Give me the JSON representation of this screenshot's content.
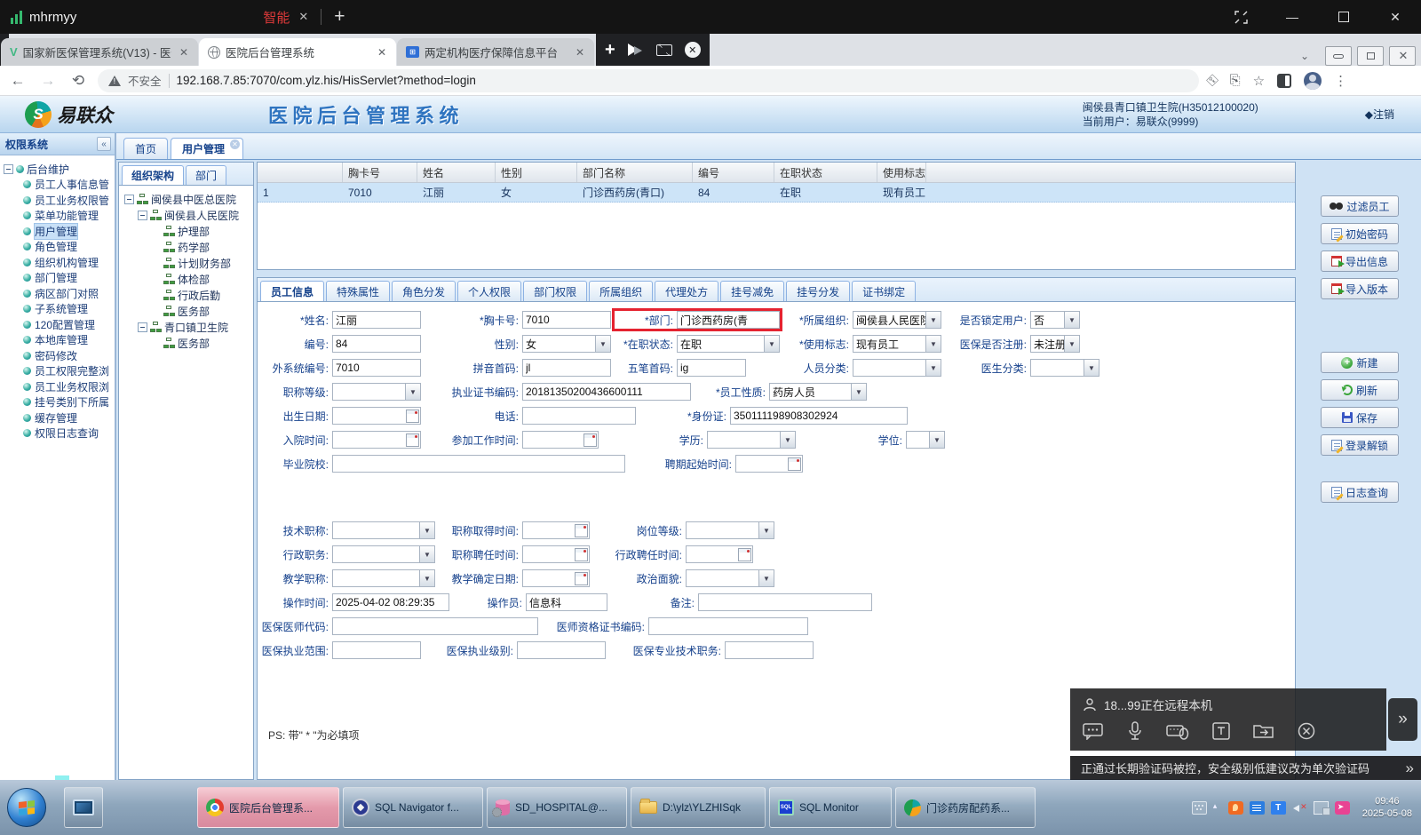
{
  "window": {
    "title": "mhrmyy",
    "smart_tab": "智能",
    "close": "✕",
    "plus": "+",
    "minimize": "—"
  },
  "browser": {
    "tabs": [
      {
        "label": "国家新医保管理系统(V13) - 医保"
      },
      {
        "label": "医院后台管理系统",
        "active": true
      },
      {
        "label": "两定机构医疗保障信息平台"
      }
    ],
    "address": {
      "security": "不安全",
      "url": "192.168.7.85:7070/com.ylz.his/HisServlet?method=login"
    }
  },
  "app_header": {
    "brand": "易联众",
    "title": "医 院 后 台 管 理 系 统",
    "org": "闽侯县青口镇卫生院(H35012100020)",
    "current_user": "当前用户：易联众(9999)",
    "logout": "◆注销"
  },
  "perm_sidebar": {
    "title": "权限系统",
    "collapse": "«",
    "root": "后台维护",
    "items": [
      {
        "label": "员工人事信息管"
      },
      {
        "label": "员工业务权限管"
      },
      {
        "label": "菜单功能管理"
      },
      {
        "label": "用户管理",
        "selected": true
      },
      {
        "label": "角色管理"
      },
      {
        "label": "组织机构管理"
      },
      {
        "label": "部门管理"
      },
      {
        "label": "病区部门对照"
      },
      {
        "label": "子系统管理"
      },
      {
        "label": "120配置管理"
      },
      {
        "label": "本地库管理"
      },
      {
        "label": "密码修改"
      },
      {
        "label": "员工权限完整浏"
      },
      {
        "label": "员工业务权限浏"
      },
      {
        "label": "挂号类别下所属"
      },
      {
        "label": "缓存管理"
      },
      {
        "label": "权限日志查询"
      }
    ]
  },
  "page_tabs": {
    "home": "首页",
    "current": "用户管理"
  },
  "org_panel": {
    "tabs": {
      "org": "组织架构",
      "dept": "部门"
    },
    "tree": [
      {
        "label": "闽侯县中医总医院",
        "level": 0,
        "expand": true
      },
      {
        "label": "闽侯县人民医院",
        "level": 1,
        "expand": true
      },
      {
        "label": "护理部",
        "level": 2
      },
      {
        "label": "药学部",
        "level": 2
      },
      {
        "label": "计划财务部",
        "level": 2
      },
      {
        "label": "体检部",
        "level": 2
      },
      {
        "label": "行政后勤",
        "level": 2
      },
      {
        "label": "医务部",
        "level": 2
      },
      {
        "label": "青口镇卫生院",
        "level": 1,
        "expand": true
      },
      {
        "label": "医务部",
        "level": 2
      }
    ]
  },
  "emp_table": {
    "columns": [
      "",
      "胸卡号",
      "姓名",
      "性别",
      "部门名称",
      "编号",
      "在职状态",
      "使用标志"
    ],
    "row": [
      "1",
      "7010",
      "江丽",
      "女",
      "门诊西药房(青口)",
      "84",
      "在职",
      "现有员工"
    ]
  },
  "right_buttons": {
    "filter": "过滤员工",
    "init_pwd": "初始密码",
    "export": "导出信息",
    "import": "导入版本",
    "new": "新建",
    "refresh": "刷新",
    "save": "保存",
    "unlock": "登录解锁",
    "log": "日志查询"
  },
  "detail_tabs": [
    "员工信息",
    "特殊属性",
    "角色分发",
    "个人权限",
    "部门权限",
    "所属组织",
    "代理处方",
    "挂号减免",
    "挂号分发",
    "证书绑定"
  ],
  "form": {
    "ps_note": "PS: 带\" * \"为必填项",
    "rows": [
      {
        "fields": [
          {
            "label": "*姓名:",
            "value": "江丽",
            "type": "text",
            "lw": 80,
            "iw": 100
          },
          {
            "label": "*胸卡号:",
            "value": "7010",
            "type": "text",
            "lw": 110,
            "iw": 100
          },
          {
            "label": "*部门:",
            "value": "门诊西药房(青",
            "type": "text",
            "lw": 70,
            "iw": 116,
            "highlight": true
          },
          {
            "label": "*所属组织:",
            "value": "闽侯县人民医院",
            "type": "select",
            "lw": 78,
            "iw": 100
          },
          {
            "label": "是否锁定用户:",
            "value": "否",
            "type": "select",
            "lw": 96,
            "iw": 56
          }
        ]
      },
      {
        "fields": [
          {
            "label": "编号:",
            "value": "84",
            "type": "text",
            "lw": 80,
            "iw": 100
          },
          {
            "label": "性别:",
            "value": "女",
            "type": "select",
            "lw": 110,
            "iw": 100
          },
          {
            "label": "*在职状态:",
            "value": "在职",
            "type": "select",
            "lw": 70,
            "iw": 116
          },
          {
            "label": "*使用标志:",
            "value": "现有员工",
            "type": "select",
            "lw": 78,
            "iw": 100
          },
          {
            "label": "医保是否注册:",
            "value": "未注册",
            "type": "select",
            "lw": 96,
            "iw": 56
          }
        ]
      },
      {
        "fields": [
          {
            "label": "外系统编号:",
            "value": "7010",
            "type": "text",
            "lw": 80,
            "iw": 100
          },
          {
            "label": "拼音首码:",
            "value": "jl",
            "type": "text",
            "lw": 110,
            "iw": 100
          },
          {
            "label": "五笔首码:",
            "value": "ig",
            "type": "text",
            "lw": 70,
            "iw": 78
          },
          {
            "label": "人员分类:",
            "value": "",
            "type": "select",
            "lw": 116,
            "iw": 100
          },
          {
            "label": "医生分类:",
            "value": "",
            "type": "select",
            "lw": 96,
            "iw": 78
          }
        ]
      },
      {
        "fields": [
          {
            "label": "职称等级:",
            "value": "",
            "type": "select",
            "lw": 80,
            "iw": 100
          },
          {
            "label": "执业证书编码:",
            "value": "20181350200436600111",
            "type": "text",
            "lw": 110,
            "iw": 190
          },
          {
            "label": "*员工性质:",
            "value": "药房人员",
            "type": "select",
            "lw": 84,
            "iw": 110
          }
        ]
      },
      {
        "fields": [
          {
            "label": "出生日期:",
            "value": "",
            "type": "date",
            "lw": 80,
            "iw": 100
          },
          {
            "label": "电话:",
            "value": "",
            "type": "text",
            "lw": 110,
            "iw": 128
          },
          {
            "label": "*身份证:",
            "value": "350111198908302924",
            "type": "text",
            "lw": 102,
            "iw": 200
          }
        ]
      },
      {
        "fields": [
          {
            "label": "入院时间:",
            "value": "",
            "type": "date",
            "lw": 80,
            "iw": 100
          },
          {
            "label": "参加工作时间:",
            "value": "",
            "type": "date",
            "lw": 110,
            "iw": 86
          },
          {
            "label": "学历:",
            "value": "",
            "type": "select",
            "lw": 118,
            "iw": 100
          },
          {
            "label": "学位:",
            "value": "",
            "type": "select",
            "lw": 120,
            "iw": 44
          }
        ]
      },
      {
        "fields": [
          {
            "label": "毕业院校:",
            "value": "",
            "type": "text",
            "lw": 80,
            "iw": 330
          },
          {
            "label": "聘期起始时间:",
            "value": "",
            "type": "date",
            "lw": 120,
            "iw": 76
          }
        ]
      },
      {
        "spacer": 48
      },
      {
        "fields": [
          {
            "label": "技术职称:",
            "value": "",
            "type": "select",
            "lw": 80,
            "iw": 116
          },
          {
            "label": "职称取得时间:",
            "value": "",
            "type": "date",
            "lw": 94,
            "iw": 76
          },
          {
            "label": "岗位等级:",
            "value": "",
            "type": "select",
            "lw": 104,
            "iw": 100
          }
        ]
      },
      {
        "fields": [
          {
            "label": "行政职务:",
            "value": "",
            "type": "select",
            "lw": 80,
            "iw": 116
          },
          {
            "label": "职称聘任时间:",
            "value": "",
            "type": "date",
            "lw": 94,
            "iw": 76
          },
          {
            "label": "行政聘任时间:",
            "value": "",
            "type": "date",
            "lw": 104,
            "iw": 76
          }
        ]
      },
      {
        "fields": [
          {
            "label": "教学职称:",
            "value": "",
            "type": "select",
            "lw": 80,
            "iw": 116
          },
          {
            "label": "教学确定日期:",
            "value": "",
            "type": "date",
            "lw": 94,
            "iw": 76
          },
          {
            "label": "政治面貌:",
            "value": "",
            "type": "select",
            "lw": 104,
            "iw": 100
          }
        ]
      },
      {
        "fields": [
          {
            "label": "操作时间:",
            "value": "2025-04-02 08:29:35",
            "type": "text",
            "lw": 80,
            "iw": 132
          },
          {
            "label": "操作员:",
            "value": "信息科",
            "type": "text",
            "lw": 82,
            "iw": 92
          },
          {
            "label": "备注:",
            "value": "",
            "type": "text",
            "lw": 98,
            "iw": 196
          }
        ]
      },
      {
        "fields": [
          {
            "label": "医保医师代码:",
            "value": "",
            "type": "text",
            "lw": 80,
            "iw": 232
          },
          {
            "label": "医师资格证书编码:",
            "value": "",
            "type": "text",
            "lw": 120,
            "iw": 180
          }
        ]
      },
      {
        "fields": [
          {
            "label": "医保执业范围:",
            "value": "",
            "type": "text",
            "lw": 80,
            "iw": 100
          },
          {
            "label": "医保执业级别:",
            "value": "",
            "type": "text",
            "lw": 104,
            "iw": 100
          },
          {
            "label": "医保专业技术职务:",
            "value": "",
            "type": "text",
            "lw": 130,
            "iw": 100
          }
        ]
      }
    ]
  },
  "remote": {
    "status": "18...99正在远程本机",
    "warning": "正通过长期验证码被控，安全级别低建议改为单次验证码",
    "chevron": "»"
  },
  "taskbar": {
    "buttons": [
      {
        "label": "医院后台管理系..."
      },
      {
        "label": "SQL Navigator f..."
      },
      {
        "label": "SD_HOSPITAL@..."
      },
      {
        "label": "D:\\ylz\\YLZHISqk"
      },
      {
        "label": "SQL Monitor"
      },
      {
        "label": "门诊药房配药系..."
      }
    ],
    "clock": {
      "time": "09:46",
      "date": "2025-05-08"
    }
  }
}
